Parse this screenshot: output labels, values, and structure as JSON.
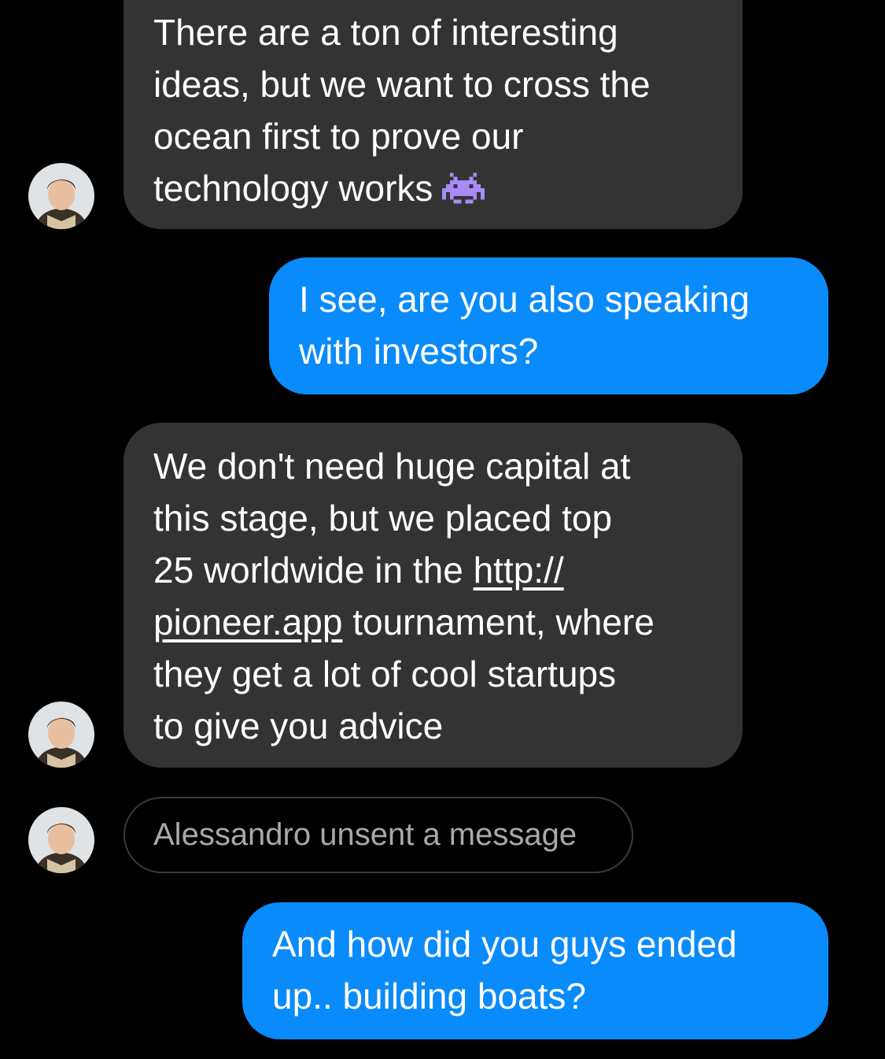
{
  "thread": {
    "messages": [
      {
        "direction": "incoming",
        "lines": [
          "There are a ton of interesting",
          "ideas, but we want to cross the",
          "ocean first to prove our",
          "technology works"
        ],
        "emoji": "alien-monster-icon"
      },
      {
        "direction": "outgoing",
        "lines": [
          "I see, are you also speaking",
          "with investors?"
        ]
      },
      {
        "direction": "incoming",
        "line1": "We don't need huge capital at",
        "line2": "this stage, but we placed top",
        "line3_text": "25 worldwide in the ",
        "line3_link": "http://",
        "line4_link": "pioneer.app",
        "line4_text": " tournament, where",
        "line5": "they get a lot of cool startups",
        "line6": "to give you advice"
      },
      {
        "direction": "system",
        "text": "Alessandro unsent a message"
      },
      {
        "direction": "outgoing",
        "lines": [
          "And how did you guys ended",
          "up.. building boats?"
        ]
      }
    ]
  },
  "colors": {
    "background": "#000000",
    "incoming_bubble": "#333333",
    "outgoing_bubble": "#0a8bfb",
    "unsent_text": "#a8a8ac",
    "emoji": "#a78bfa"
  }
}
